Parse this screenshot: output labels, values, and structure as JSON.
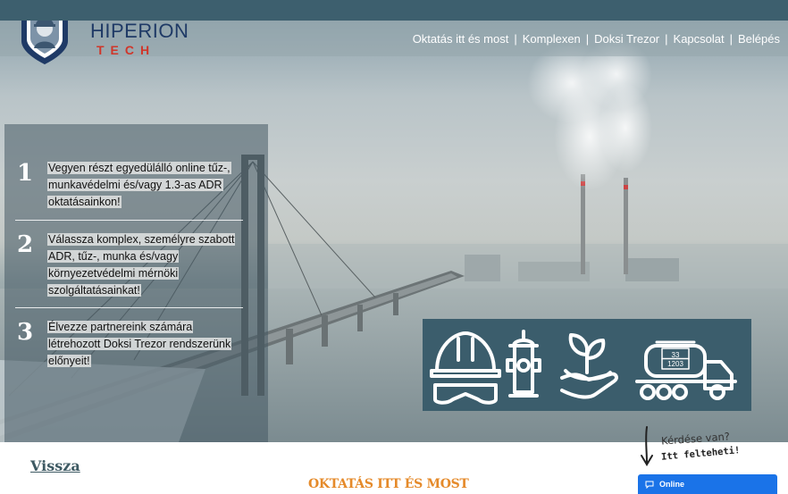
{
  "brand": {
    "title": "HIPERION",
    "subtitle": "TECH",
    "colors": {
      "title": "#1f3a66",
      "subtitle": "#d0362a",
      "shield": "#1f3a66"
    }
  },
  "nav": {
    "items": [
      "Oktatás itt és most",
      "Komplexen",
      "Doksi Trezor",
      "Kapcsolat",
      "Belépés"
    ],
    "separator": "|"
  },
  "steps": [
    {
      "number": "1",
      "text": "Vegyen részt egyedülálló online tűz-, munkavédelmi és/vagy 1.3-as ADR oktatásainkon!"
    },
    {
      "number": "2",
      "text": "Válassza komplex, személyre szabott ADR, tűz-, munka és/vagy környezetvédelmi mérnöki szolgáltatásainkat!"
    },
    {
      "number": "3",
      "text": "Élvezze partnereink számára létrehozott Doksi Trezor rendszerünk előnyeit!"
    }
  ],
  "services_icons": [
    "hard-hat-goggles-icon",
    "fire-hydrant-icon",
    "plant-hand-icon",
    "tank-truck-icon"
  ],
  "tank_plate": {
    "top": "33",
    "bottom": "1203"
  },
  "back_link": "Vissza",
  "section_title": "OKTATÁS ITT ÉS MOST",
  "question": {
    "line1": "Kérdése van?",
    "line2": "Itt felteheti!"
  },
  "chat": {
    "label": "Online",
    "color": "#1a73e8"
  },
  "theme": {
    "topbar": "#3d5f6e",
    "accent": "#e58a2a",
    "box": "#3b5d6c"
  }
}
